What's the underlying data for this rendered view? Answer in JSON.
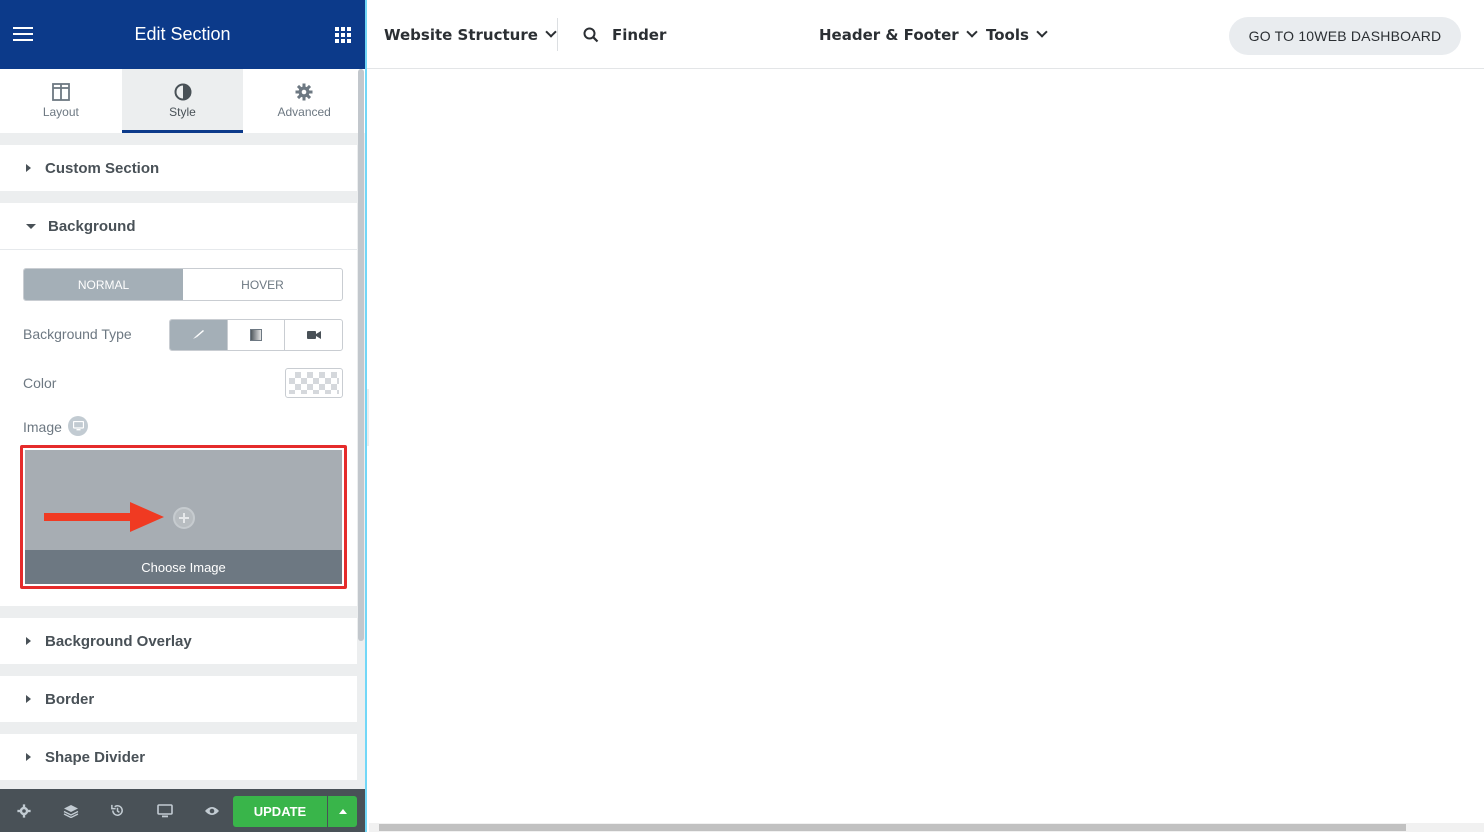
{
  "panel": {
    "title": "Edit Section",
    "tabs": [
      {
        "label": "Layout",
        "icon": "layout-icon"
      },
      {
        "label": "Style",
        "icon": "contrast-icon"
      },
      {
        "label": "Advanced",
        "icon": "gear-icon"
      }
    ],
    "sections": {
      "custom_section": "Custom Section",
      "background": "Background",
      "background_overlay": "Background Overlay",
      "border": "Border",
      "shape_divider": "Shape Divider"
    },
    "background": {
      "state_normal": "NORMAL",
      "state_hover": "HOVER",
      "background_type_label": "Background Type",
      "color_label": "Color",
      "image_label": "Image",
      "choose_image": "Choose Image"
    },
    "footer": {
      "update_label": "UPDATE"
    }
  },
  "topbar": {
    "website_structure": "Website Structure",
    "finder": "Finder",
    "header_footer": "Header & Footer",
    "tools": "Tools",
    "dashboard_button": "GO TO 10WEB DASHBOARD"
  },
  "colors": {
    "panel_header": "#0c3a8a",
    "update_green": "#39b54a",
    "highlight_red": "#e52b2b",
    "annotation_arrow": "#f03a22"
  }
}
